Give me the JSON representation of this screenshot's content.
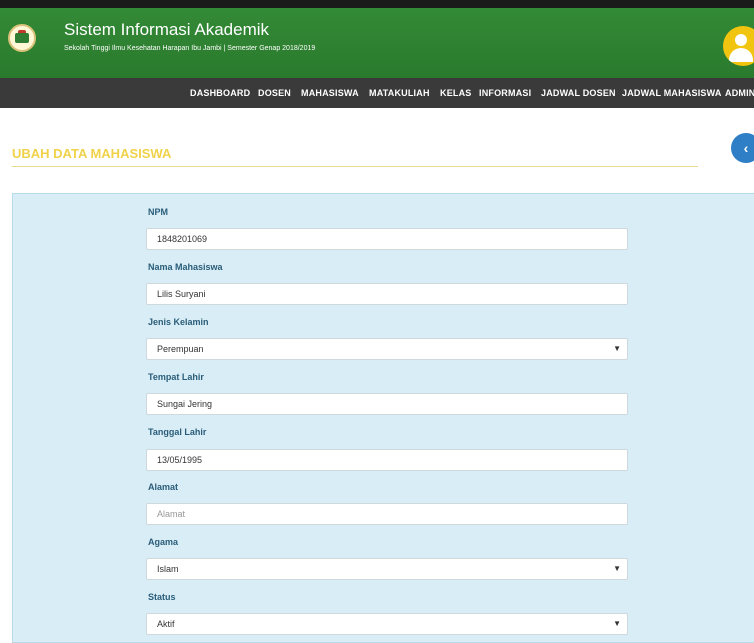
{
  "header": {
    "title": "Sistem Informasi Akademik",
    "subtitle": "Sekolah Tinggi Ilmu Kesehatan Harapan Ibu Jambi | Semester Genap 2018/2019"
  },
  "nav": {
    "items": [
      "DASHBOARD",
      "DOSEN",
      "MAHASISWA",
      "MATAKULIAH",
      "KELAS",
      "INFORMASI",
      "JADWAL DOSEN",
      "JADWAL MAHASISWA",
      "ADMIN"
    ]
  },
  "page": {
    "heading": "UBAH DATA MAHASISWA",
    "back_icon": "‹"
  },
  "form": {
    "npm_label": "NPM",
    "npm_value": "1848201069",
    "nama_label": "Nama Mahasiswa",
    "nama_value": "Lilis Suryani",
    "jk_label": "Jenis Kelamin",
    "jk_value": "Perempuan",
    "tempat_label": "Tempat Lahir",
    "tempat_value": "Sungai Jering",
    "tanggal_label": "Tanggal Lahir",
    "tanggal_value": "13/05/1995",
    "alamat_label": "Alamat",
    "alamat_placeholder": "Alamat",
    "agama_label": "Agama",
    "agama_value": "Islam",
    "status_label": "Status",
    "status_value": "Aktif"
  },
  "colors": {
    "header_green": "#2e7d32",
    "nav_dark": "#3a3a3a",
    "heading_yellow": "#f0d24a",
    "panel_blue": "#d8edf5",
    "back_blue": "#2f7fc7"
  }
}
